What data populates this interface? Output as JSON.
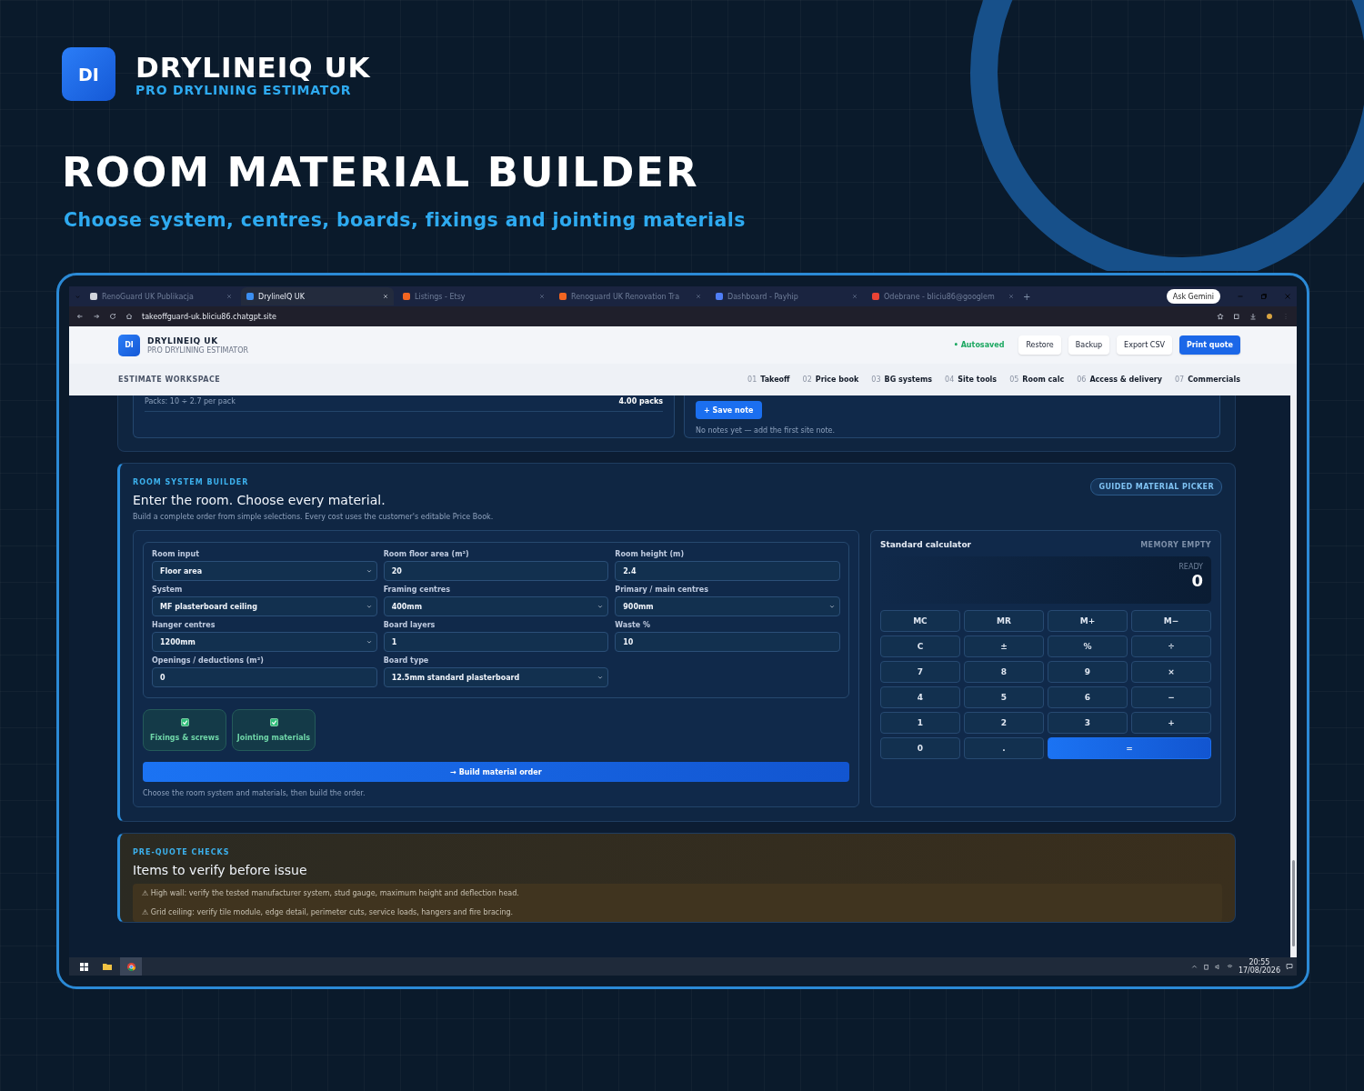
{
  "branding": {
    "logo": "DI",
    "name": "DRYLINEIQ UK",
    "tagline": "PRO DRYLINING ESTIMATOR"
  },
  "headline": "ROOM MATERIAL BUILDER",
  "subheadline": "Choose system, centres, boards, fixings and jointing materials",
  "browser": {
    "tabs": [
      {
        "title": "RenoGuard UK Publikacja",
        "selected": false,
        "color": "#d0d4dc"
      },
      {
        "title": "DrylineIQ UK",
        "selected": true,
        "color": "#3b8ef0"
      },
      {
        "title": "Listings - Etsy",
        "selected": false,
        "color": "#f16521"
      },
      {
        "title": "Renoguard UK Renovation Tra",
        "selected": false,
        "color": "#f16521"
      },
      {
        "title": "Dashboard - Payhip",
        "selected": false,
        "color": "#4f7ef5"
      },
      {
        "title": "Odebrane - bliciu86@googlem",
        "selected": false,
        "color": "#ea4335"
      }
    ],
    "new_tab": "+",
    "ask": "Ask Gemini",
    "url": "takeoffguard-uk.bliciu86.chatgpt.site"
  },
  "app": {
    "logo": "DI",
    "name": "DRYLINEIQ UK",
    "tagline": "PRO DRYLINING ESTIMATOR",
    "status": "• Autosaved",
    "actions": [
      {
        "label": "Restore",
        "primary": false
      },
      {
        "label": "Backup",
        "primary": false
      },
      {
        "label": "Export CSV",
        "primary": false
      },
      {
        "label": "Print quote",
        "primary": true
      }
    ],
    "workspace": "ESTIMATE WORKSPACE",
    "nav": [
      {
        "number": "01",
        "label": "Takeoff"
      },
      {
        "number": "02",
        "label": "Price book"
      },
      {
        "number": "03",
        "label": "BG systems"
      },
      {
        "number": "04",
        "label": "Site tools"
      },
      {
        "number": "05",
        "label": "Room calc"
      },
      {
        "number": "06",
        "label": "Access & delivery"
      },
      {
        "number": "07",
        "label": "Commercials"
      }
    ]
  },
  "previous": {
    "pack_note": "Packs: 10 ÷ 2.7 per pack",
    "pack_total": "4.00 packs",
    "save_button": "+ Save note",
    "notes_empty": "No notes yet — add the first site note."
  },
  "builder": {
    "eyebrow": "ROOM SYSTEM BUILDER",
    "title": "Enter the room. Choose every material.",
    "description": "Build a complete order from simple selections. Every cost uses the customer's editable Price Book.",
    "badge": "GUIDED MATERIAL PICKER",
    "fields": [
      {
        "label": "Room input",
        "value": "Floor area",
        "kind": "select"
      },
      {
        "label": "Room floor area (m²)",
        "value": "20",
        "kind": "input"
      },
      {
        "label": "Room height (m)",
        "value": "2.4",
        "kind": "input"
      },
      {
        "label": "System",
        "value": "MF plasterboard ceiling",
        "kind": "select"
      },
      {
        "label": "Framing centres",
        "value": "400mm",
        "kind": "select"
      },
      {
        "label": "Primary / main centres",
        "value": "900mm",
        "kind": "select"
      },
      {
        "label": "Hanger centres",
        "value": "1200mm",
        "kind": "select"
      },
      {
        "label": "Board layers",
        "value": "1",
        "kind": "input"
      },
      {
        "label": "Waste %",
        "value": "10",
        "kind": "input"
      },
      {
        "label": "Openings / deductions (m²)",
        "value": "0",
        "kind": "input"
      },
      {
        "label": "Board type",
        "value": "12.5mm standard plasterboard",
        "kind": "select"
      }
    ],
    "options": [
      {
        "label": "Fixings & screws",
        "checked": true
      },
      {
        "label": "Jointing materials",
        "checked": true
      }
    ],
    "build_button": "→ Build material order",
    "hint": "Choose the room system and materials, then build the order."
  },
  "calculator": {
    "title": "Standard calculator",
    "memory": "MEMORY EMPTY",
    "status": "READY",
    "display": "0",
    "keys": [
      {
        "label": "MC",
        "kind": "key"
      },
      {
        "label": "MR",
        "kind": "key"
      },
      {
        "label": "M+",
        "kind": "key"
      },
      {
        "label": "M−",
        "kind": "key"
      },
      {
        "label": "C",
        "kind": "key"
      },
      {
        "label": "±",
        "kind": "key"
      },
      {
        "label": "%",
        "kind": "key"
      },
      {
        "label": "÷",
        "kind": "key"
      },
      {
        "label": "7",
        "kind": "key"
      },
      {
        "label": "8",
        "kind": "key"
      },
      {
        "label": "9",
        "kind": "key"
      },
      {
        "label": "×",
        "kind": "key"
      },
      {
        "label": "4",
        "kind": "key"
      },
      {
        "label": "5",
        "kind": "key"
      },
      {
        "label": "6",
        "kind": "key"
      },
      {
        "label": "−",
        "kind": "key"
      },
      {
        "label": "1",
        "kind": "key"
      },
      {
        "label": "2",
        "kind": "key"
      },
      {
        "label": "3",
        "kind": "key"
      },
      {
        "label": "+",
        "kind": "key"
      },
      {
        "label": "0",
        "kind": "key"
      },
      {
        "label": ".",
        "kind": "key"
      },
      {
        "label": "=",
        "kind": "equals"
      }
    ]
  },
  "checks": {
    "eyebrow": "PRE-QUOTE CHECKS",
    "title": "Items to verify before issue",
    "items": [
      "⚠ High wall: verify the tested manufacturer system, stud gauge, maximum height and deflection head.",
      "⚠ Grid ceiling: verify tile module, edge detail, perimeter cuts, service loads, hangers and fire bracing."
    ]
  },
  "taskbar": {
    "time": "20:55",
    "date": "17/08/2026"
  }
}
